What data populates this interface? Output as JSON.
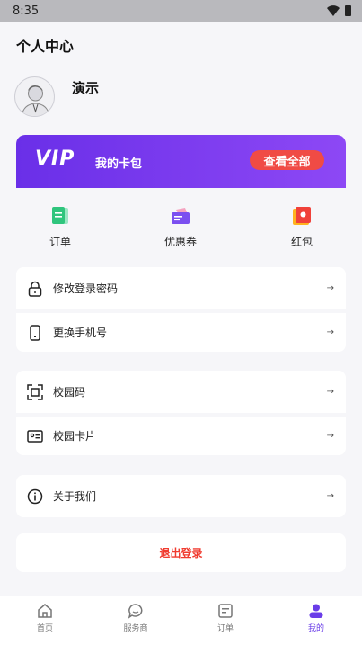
{
  "status": {
    "time": "8:35"
  },
  "page": {
    "title": "个人中心"
  },
  "profile": {
    "name": "演示"
  },
  "vip": {
    "logo": "VIP",
    "title": "我的卡包",
    "button": "查看全部"
  },
  "quick": [
    {
      "label": "订单",
      "icon": "order-doc-icon"
    },
    {
      "label": "优惠券",
      "icon": "coupon-icon"
    },
    {
      "label": "红包",
      "icon": "red-packet-icon"
    }
  ],
  "menu1": [
    {
      "label": "修改登录密码",
      "icon": "lock-icon",
      "arrow": "→"
    },
    {
      "label": "更换手机号",
      "icon": "phone-icon",
      "arrow": "→"
    }
  ],
  "menu2": [
    {
      "label": "校园码",
      "icon": "scan-code-icon",
      "arrow": "→"
    },
    {
      "label": "校园卡片",
      "icon": "id-card-icon",
      "arrow": "→"
    }
  ],
  "menu3": [
    {
      "label": "关于我们",
      "icon": "info-icon",
      "arrow": "→"
    }
  ],
  "logout": {
    "label": "退出登录"
  },
  "tabs": [
    {
      "label": "首页",
      "icon": "home-icon"
    },
    {
      "label": "服务商",
      "icon": "chat-icon"
    },
    {
      "label": "订单",
      "icon": "order-icon"
    },
    {
      "label": "我的",
      "icon": "user-icon"
    }
  ],
  "colors": {
    "accent": "#6a2fe8",
    "danger": "#f03b2f"
  }
}
